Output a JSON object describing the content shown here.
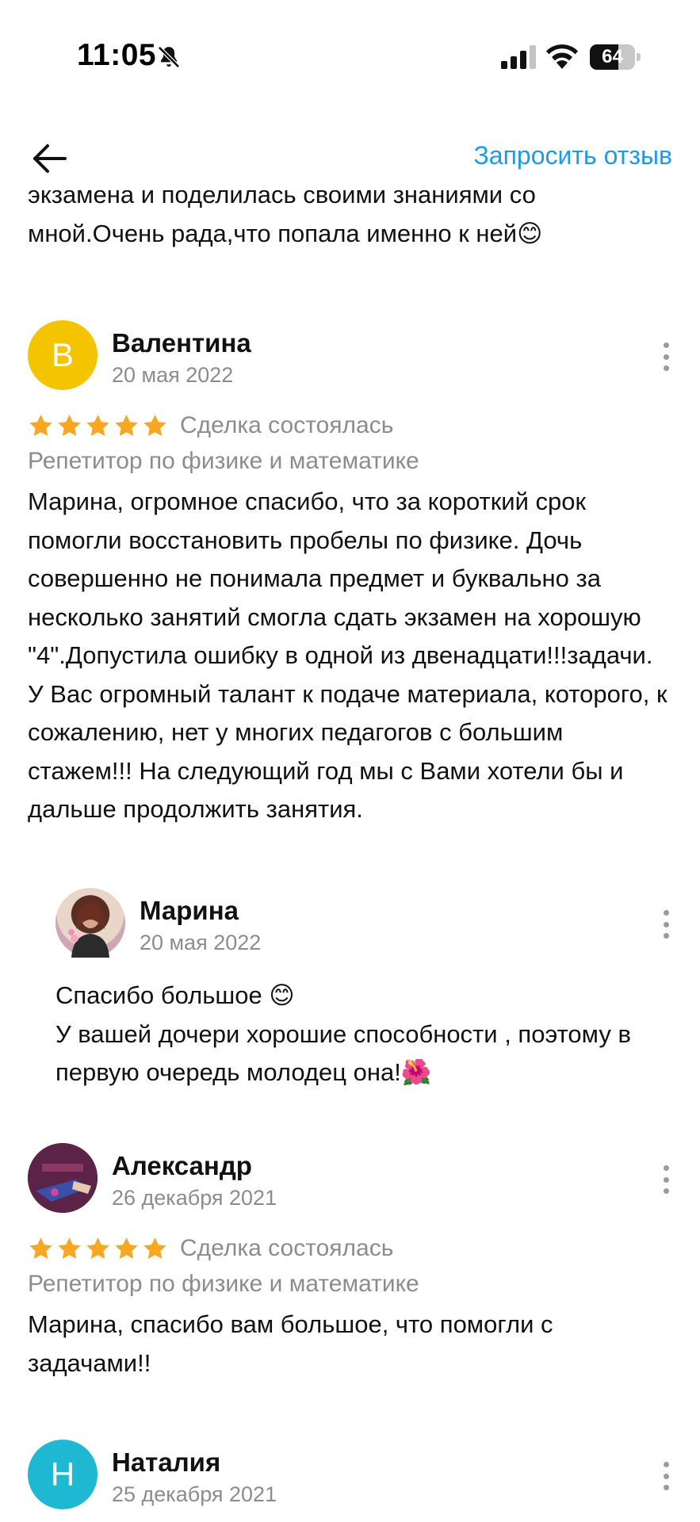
{
  "status_bar": {
    "time": "11:05",
    "battery_level": "64",
    "battery_fraction": 0.64,
    "icons": [
      "bell-muted-icon",
      "signal-icon",
      "wifi-icon",
      "battery-icon"
    ]
  },
  "nav": {
    "back_icon": "arrow-left-icon",
    "request_review_label": "Запросить отзыв",
    "accent_color": "#1a9bef"
  },
  "partial_review": {
    "text_line1": "экзамена и поделилась своими знаниями со",
    "text_line2": "мной.Очень рада,что попала именно к ней😊"
  },
  "reviews": [
    {
      "avatar_letter": "В",
      "avatar_color": "#f5c400",
      "name": "Валентина",
      "date": "20 мая 2022",
      "rating": 5,
      "deal": "Сделка состоялась",
      "category": "Репетитор по физике и математике",
      "text": "Марина, огромное спасибо, что за короткий срок помогли восстановить пробелы по физике. Дочь совершенно не понимала предмет и буквально за несколько занятий смогла сдать экзамен на хорошую \"4\".Допустила ошибку в одной из двенадцати!!!задачи. У Вас огромный талант к подаче материала, которого, к сожалению, нет у многих педагогов с большим стажем!!! На следующий год мы с Вами хотели бы и дальше продолжить занятия.",
      "reply": {
        "name": "Марина",
        "date": "20 мая 2022",
        "text": "Спасибо большое 😊\nУ вашей дочери хорошие способности , поэтому в первую очередь молодец она!🌺"
      }
    },
    {
      "avatar_letter": "",
      "avatar_color": "#4a2340",
      "name": "Александр",
      "date": "26 декабря 2021",
      "rating": 5,
      "deal": "Сделка состоялась",
      "category": "Репетитор по физике и математике",
      "text": "Марина, спасибо вам большое, что помогли с задачами!!"
    },
    {
      "avatar_letter": "Н",
      "avatar_color": "#1fb8d3",
      "name": "Наталия",
      "date": "25 декабря 2021"
    }
  ],
  "star_color": "#f7a823"
}
